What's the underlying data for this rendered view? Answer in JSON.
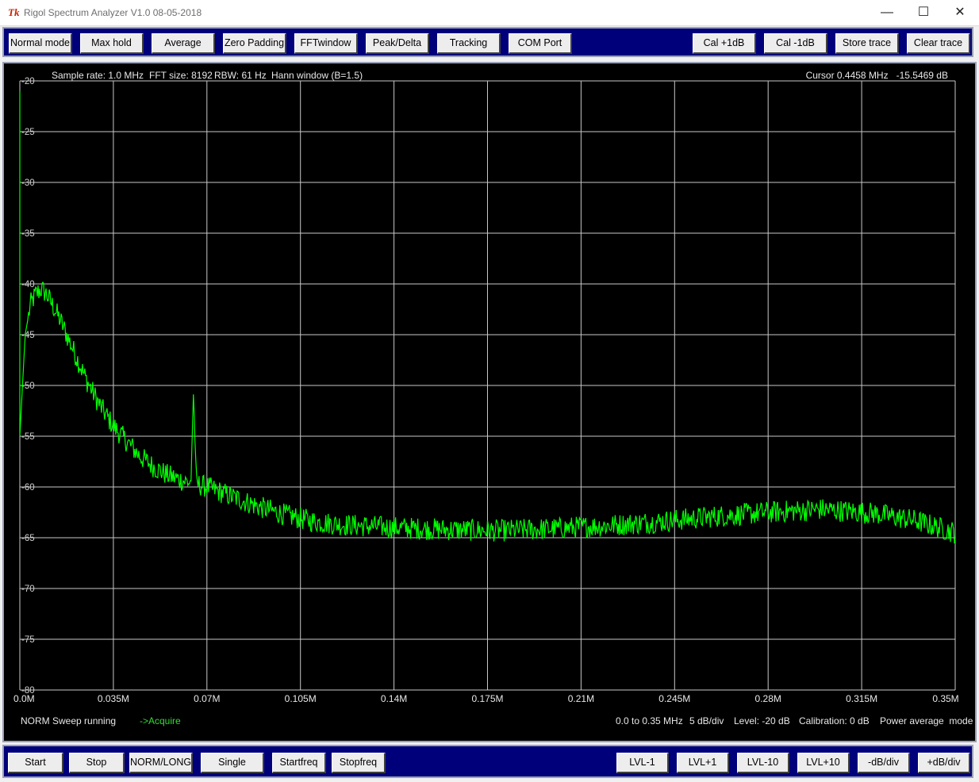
{
  "window": {
    "icon_glyph": "Tk",
    "title": "Rigol Spectrum Analyzer V1.0 08-05-2018",
    "minimize_glyph": "—",
    "maximize_glyph": "☐",
    "close_glyph": "✕"
  },
  "toolbar_top": {
    "normal_mode": "Normal mode",
    "max_hold": "Max hold",
    "average": "Average",
    "zero_padding": "Zero Padding",
    "fft_window": "FFTwindow",
    "peak_delta": "Peak/Delta",
    "tracking": "Tracking",
    "com_port": "COM Port",
    "cal_plus": "Cal +1dB",
    "cal_minus": "Cal -1dB",
    "store_trace": "Store trace",
    "clear_trace": "Clear trace"
  },
  "toolbar_bottom": {
    "start": "Start",
    "stop": "Stop",
    "norm_long": "NORM/LONG",
    "single": "Single",
    "startfreq": "Startfreq",
    "stopfreq": "Stopfreq",
    "lvl_minus1": "LVL-1",
    "lvl_plus1": "LVL+1",
    "lvl_minus10": "LVL-10",
    "lvl_plus10": "LVL+10",
    "db_div_minus": "-dB/div",
    "db_div_plus": "+dB/div"
  },
  "plot_header": {
    "sample_rate": "Sample rate: 1.0 MHz",
    "fft_size": "FFT size: 8192",
    "rbw": "RBW: 61 Hz",
    "window": "Hann window (B=1.5)",
    "cursor": "Cursor 0.4458 MHz   -15.5469 dB"
  },
  "status": {
    "sweep": "NORM Sweep running",
    "acquire": "->Acquire",
    "span": "0.0 to 0.35 MHz",
    "scale": "5 dB/div",
    "level": "Level: -20 dB",
    "calibration": "Calibration: 0 dB",
    "mode": "Power average  mode"
  },
  "colors": {
    "trace": "#00ff00",
    "grid": "#c8c8c8",
    "background": "#000000",
    "toolbar": "#00007a"
  },
  "chart_data": {
    "type": "line",
    "xlim": [
      0,
      0.35
    ],
    "ylim": [
      -80,
      -20
    ],
    "x_ticks": [
      "0.0M",
      "0.035M",
      "0.07M",
      "0.105M",
      "0.14M",
      "0.175M",
      "0.21M",
      "0.245M",
      "0.28M",
      "0.315M",
      "0.35M"
    ],
    "y_ticks": [
      "-20",
      "-25",
      "-30",
      "-35",
      "-40",
      "-45",
      "-50",
      "-55",
      "-60",
      "-65",
      "-70",
      "-75",
      "-80"
    ],
    "grid": true,
    "series": [
      {
        "x": [
          0.0,
          0.002,
          0.004,
          0.006,
          0.008,
          0.01,
          0.015,
          0.02,
          0.025,
          0.03,
          0.035,
          0.04,
          0.045,
          0.05,
          0.055,
          0.06,
          0.064,
          0.065,
          0.066,
          0.07,
          0.08,
          0.09,
          0.1,
          0.11,
          0.12,
          0.14,
          0.16,
          0.18,
          0.2,
          0.22,
          0.24,
          0.26,
          0.28,
          0.3,
          0.32,
          0.335,
          0.35
        ],
        "y": [
          -55,
          -45,
          -42,
          -41,
          -40.5,
          -41,
          -43.5,
          -46.5,
          -49.5,
          -52,
          -54,
          -55.5,
          -57,
          -58,
          -58.8,
          -59.3,
          -59.6,
          -50.5,
          -59.7,
          -60,
          -61,
          -62,
          -62.8,
          -63.4,
          -63.7,
          -64,
          -64.2,
          -64.3,
          -64.1,
          -63.8,
          -63.4,
          -62.9,
          -62.5,
          -62.2,
          -62.6,
          -63.3,
          -64.5
        ]
      }
    ]
  }
}
